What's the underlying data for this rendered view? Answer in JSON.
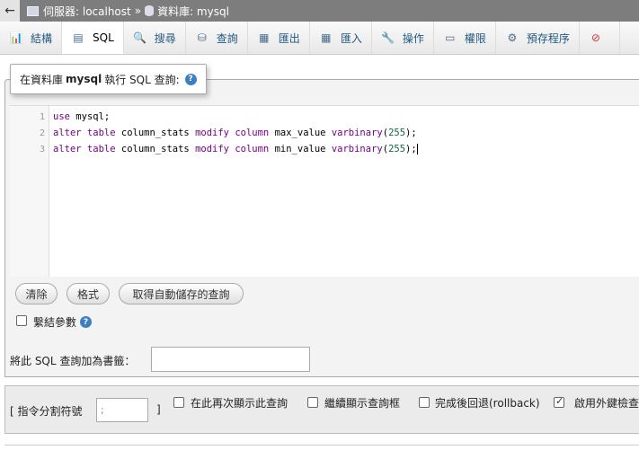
{
  "breadcrumb": {
    "server_label": "伺服器: localhost",
    "separator": "»",
    "database_label": "資料庫: mysql"
  },
  "tabs": [
    {
      "label": "結構",
      "icon": "structure-icon"
    },
    {
      "label": "SQL",
      "icon": "sql-icon"
    },
    {
      "label": "搜尋",
      "icon": "search-icon"
    },
    {
      "label": "查詢",
      "icon": "query-icon"
    },
    {
      "label": "匯出",
      "icon": "export-icon"
    },
    {
      "label": "匯入",
      "icon": "import-icon"
    },
    {
      "label": "操作",
      "icon": "wrench-icon"
    },
    {
      "label": "權限",
      "icon": "privileges-icon"
    },
    {
      "label": "預存程序",
      "icon": "routines-icon"
    }
  ],
  "legend": {
    "prefix": "在資料庫",
    "db": "mysql",
    "suffix": "執行 SQL 查詢:"
  },
  "editor": {
    "line_numbers": [
      "1",
      "2",
      "3"
    ],
    "lines": [
      "use mysql;",
      "alter table column_stats modify column max_value varbinary(255);",
      "alter table column_stats modify column min_value varbinary(255);"
    ]
  },
  "buttons": {
    "clear": "清除",
    "format": "格式",
    "autosave": "取得自動儲存的查詢"
  },
  "bind_params_label": "繫結參數",
  "bookmark_label": "將此 SQL 查詢加為書籤：",
  "footer": {
    "delimiter_label": "[ 指令分割符號",
    "delimiter_value": ";",
    "delimiter_close": "]",
    "show_again_label": "在此再次顯示此查詢",
    "retain_box_label": "繼續顯示查詢框",
    "rollback_label": "完成後回退(rollback)",
    "fk_label": "啟用外鍵檢查"
  }
}
